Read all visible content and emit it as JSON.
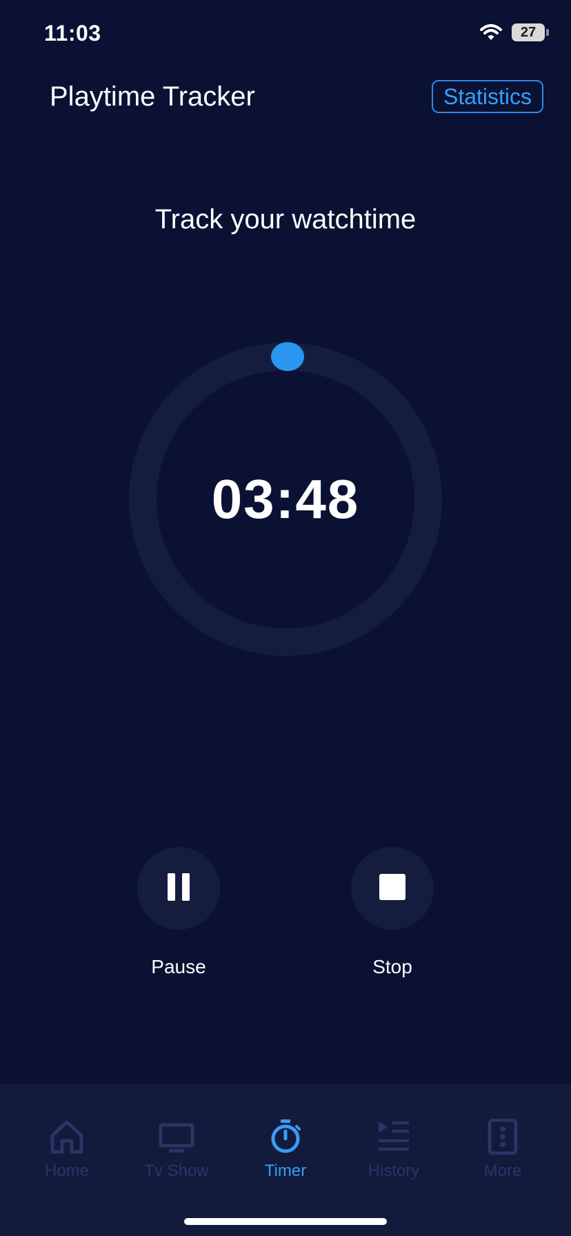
{
  "status_bar": {
    "time": "11:03",
    "battery": "27"
  },
  "header": {
    "title": "Playtime Tracker",
    "statistics_label": "Statistics"
  },
  "main": {
    "subtitle": "Track your watchtime",
    "timer_value": "03:48",
    "progress_fraction": 0
  },
  "controls": {
    "pause_label": "Pause",
    "stop_label": "Stop"
  },
  "tabs": [
    {
      "label": "Home",
      "icon": "home-icon",
      "active": false
    },
    {
      "label": "Tv Show",
      "icon": "tv-icon",
      "active": false
    },
    {
      "label": "Timer",
      "icon": "stopwatch-icon",
      "active": true
    },
    {
      "label": "History",
      "icon": "playlist-icon",
      "active": false
    },
    {
      "label": "More",
      "icon": "more-icon",
      "active": false
    }
  ],
  "colors": {
    "background": "#0b1133",
    "accent": "#36a0ff",
    "ring_track": "#141d3d",
    "tab_bar": "#131b3c",
    "tab_inactive": "#2a3566"
  }
}
